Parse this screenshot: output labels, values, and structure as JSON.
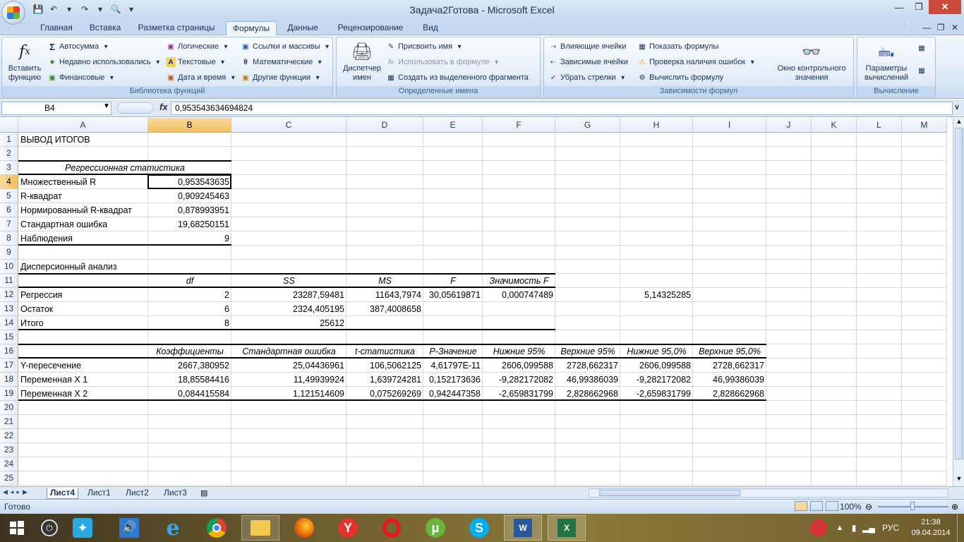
{
  "window": {
    "title": "Задача2Готова - Microsoft Excel"
  },
  "ribbon_tabs": [
    "Главная",
    "Вставка",
    "Разметка страницы",
    "Формулы",
    "Данные",
    "Рецензирование",
    "Вид"
  ],
  "ribbon": {
    "insert_function": "Вставить функцию",
    "function_library": {
      "label": "Библиотека функций",
      "autosum": "Автосумма",
      "recent": "Недавно использовались",
      "financial": "Финансовые",
      "logical": "Логические",
      "text": "Текстовые",
      "datetime": "Дата и время",
      "lookup": "Ссылки и массивы",
      "math": "Математические",
      "more": "Другие функции"
    },
    "defined_names": {
      "label": "Определенные имена",
      "manager": "Диспетчер имен",
      "define": "Присвоить имя",
      "use_in_formula": "Использовать в формуле",
      "create_from_selection": "Создать из выделенного фрагмента"
    },
    "formula_auditing": {
      "label": "Зависимости формул",
      "trace_precedents": "Влияющие ячейки",
      "trace_dependents": "Зависимые ячейки",
      "remove_arrows": "Убрать стрелки",
      "show_formulas": "Показать формулы",
      "error_checking": "Проверка наличия ошибок",
      "evaluate": "Вычислить формулу",
      "watch_window": "Окно контрольного значения"
    },
    "calculation": {
      "label": "Вычисление",
      "options": "Параметры вычислений"
    }
  },
  "formula_bar": {
    "name_box": "B4",
    "fx": "fx",
    "value": "0,953543634694824"
  },
  "columns": [
    "A",
    "B",
    "C",
    "D",
    "E",
    "F",
    "G",
    "H",
    "I",
    "J",
    "K",
    "L",
    "M"
  ],
  "rows": [
    "1",
    "2",
    "3",
    "4",
    "5",
    "6",
    "7",
    "8",
    "9",
    "10",
    "11",
    "12",
    "13",
    "14",
    "15",
    "16",
    "17",
    "18",
    "19",
    "20",
    "21",
    "22",
    "23",
    "24",
    "25"
  ],
  "cells": {
    "A1": "ВЫВОД ИТОГОВ",
    "A3": "Регрессионная статистика",
    "A4": "Множественный R",
    "B4": "0,953543635",
    "A5": "R-квадрат",
    "B5": "0,909245463",
    "A6": "Нормированный R-квадрат",
    "B6": "0,878993951",
    "A7": "Стандартная ошибка",
    "B7": "19,68250151",
    "A8": "Наблюдения",
    "B8": "9",
    "A10": "Дисперсионный анализ",
    "B11": "df",
    "C11": "SS",
    "D11": "MS",
    "E11": "F",
    "F11": "Значимость F",
    "A12": "Регрессия",
    "B12": "2",
    "C12": "23287,59481",
    "D12": "11643,7974",
    "E12": "30,05619871",
    "F12": "0,000747489",
    "H12": "5,14325285",
    "A13": "Остаток",
    "B13": "6",
    "C13": "2324,405195",
    "D13": "387,4008658",
    "A14": "Итого",
    "B14": "8",
    "C14": "25612",
    "B16": "Коэффициенты",
    "C16": "Стандартная ошибка",
    "D16": "t-статистика",
    "E16": "P-Значение",
    "F16": "Нижние 95%",
    "G16": "Верхние 95%",
    "H16": "Нижние 95,0%",
    "I16": "Верхние 95,0%",
    "A17": "Y-пересечение",
    "B17": "2667,380952",
    "C17": "25,04436961",
    "D17": "106,5062125",
    "E17": "4,61797E-11",
    "F17": "2606,099588",
    "G17": "2728,662317",
    "H17": "2606,099588",
    "I17": "2728,662317",
    "A18": "Переменная X 1",
    "B18": "18,85584416",
    "C18": "11,49939924",
    "D18": "1,639724281",
    "E18": "0,152173636",
    "F18": "-9,282172082",
    "G18": "46,99386039",
    "H18": "-9,282172082",
    "I18": "46,99386039",
    "A19": "Переменная X 2",
    "B19": "0,084415584",
    "C19": "1,121514609",
    "D19": "0,075269269",
    "E19": "0,942447358",
    "F19": "-2,659831799",
    "G19": "2,828662968",
    "H19": "-2,659831799",
    "I19": "2,828662968"
  },
  "sheets": [
    "Лист4",
    "Лист1",
    "Лист2",
    "Лист3"
  ],
  "status": {
    "ready": "Готово",
    "zoom": "100%"
  },
  "taskbar": {
    "language": "РУС",
    "time": "21:38",
    "date": "09.04.2014"
  }
}
